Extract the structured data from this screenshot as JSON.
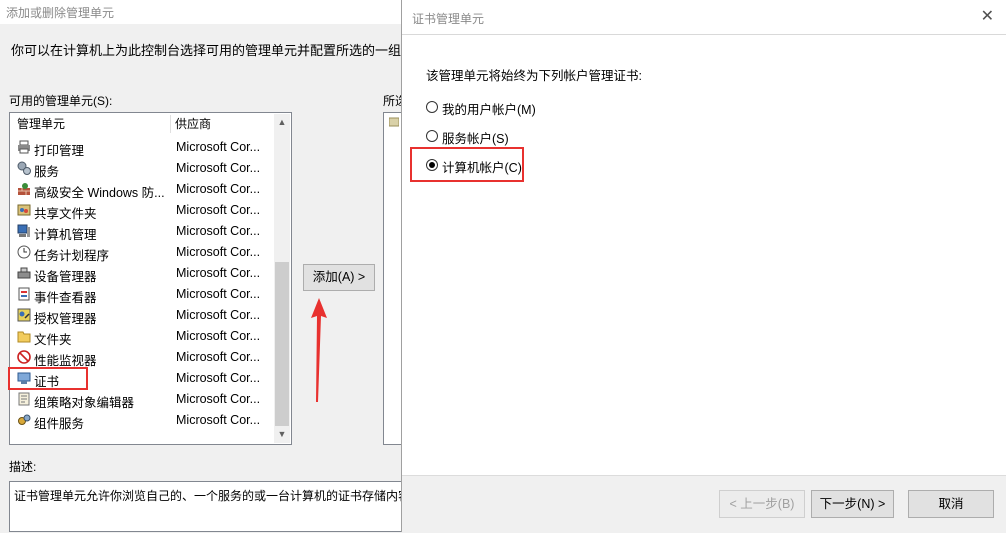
{
  "bg_dialog": {
    "title": "添加或删除管理单元",
    "intro": "你可以在计算机上为此控制台选择可用的管理单元并配置所选的一组管理单",
    "available_label": "可用的管理单元(S):",
    "selected_label": "所选",
    "columns": [
      "管理单元",
      "供应商"
    ],
    "snapins": [
      {
        "name": "打印管理",
        "vendor": "Microsoft Cor...",
        "icon": "printer-icon"
      },
      {
        "name": "服务",
        "vendor": "Microsoft Cor...",
        "icon": "gears-icon"
      },
      {
        "name": "高级安全 Windows 防...",
        "vendor": "Microsoft Cor...",
        "icon": "firewall-icon"
      },
      {
        "name": "共享文件夹",
        "vendor": "Microsoft Cor...",
        "icon": "shared-folder-icon"
      },
      {
        "name": "计算机管理",
        "vendor": "Microsoft Cor...",
        "icon": "computer-management-icon"
      },
      {
        "name": "任务计划程序",
        "vendor": "Microsoft Cor...",
        "icon": "clock-icon"
      },
      {
        "name": "设备管理器",
        "vendor": "Microsoft Cor...",
        "icon": "device-manager-icon"
      },
      {
        "name": "事件查看器",
        "vendor": "Microsoft Cor...",
        "icon": "event-viewer-icon"
      },
      {
        "name": "授权管理器",
        "vendor": "Microsoft Cor...",
        "icon": "authorization-icon"
      },
      {
        "name": "文件夹",
        "vendor": "Microsoft Cor...",
        "icon": "folder-icon"
      },
      {
        "name": "性能监视器",
        "vendor": "Microsoft Cor...",
        "icon": "no-entry-icon"
      },
      {
        "name": "证书",
        "vendor": "Microsoft Cor...",
        "icon": "certificate-icon"
      },
      {
        "name": "组策略对象编辑器",
        "vendor": "Microsoft Cor...",
        "icon": "policy-icon"
      },
      {
        "name": "组件服务",
        "vendor": "Microsoft Cor...",
        "icon": "component-services-icon"
      }
    ],
    "add_button": "添加(A) >",
    "description_label": "描述:",
    "description": "证书管理单元允许你浏览自己的、一个服务的或一台计算机的证书存储内容"
  },
  "wizard": {
    "title": "证书管理单元",
    "prompt": "该管理单元将始终为下列帐户管理证书:",
    "options": [
      {
        "label": "我的用户帐户(M)",
        "selected": false
      },
      {
        "label": "服务帐户(S)",
        "selected": false
      },
      {
        "label": "计算机帐户(C)",
        "selected": true
      }
    ],
    "back_button": "< 上一步(B)",
    "next_button": "下一步(N) >",
    "cancel_button": "取消"
  },
  "colors": {
    "highlight": "#e8312f",
    "window_bg": "#f0f0f0",
    "list_bg": "#ffffff"
  }
}
